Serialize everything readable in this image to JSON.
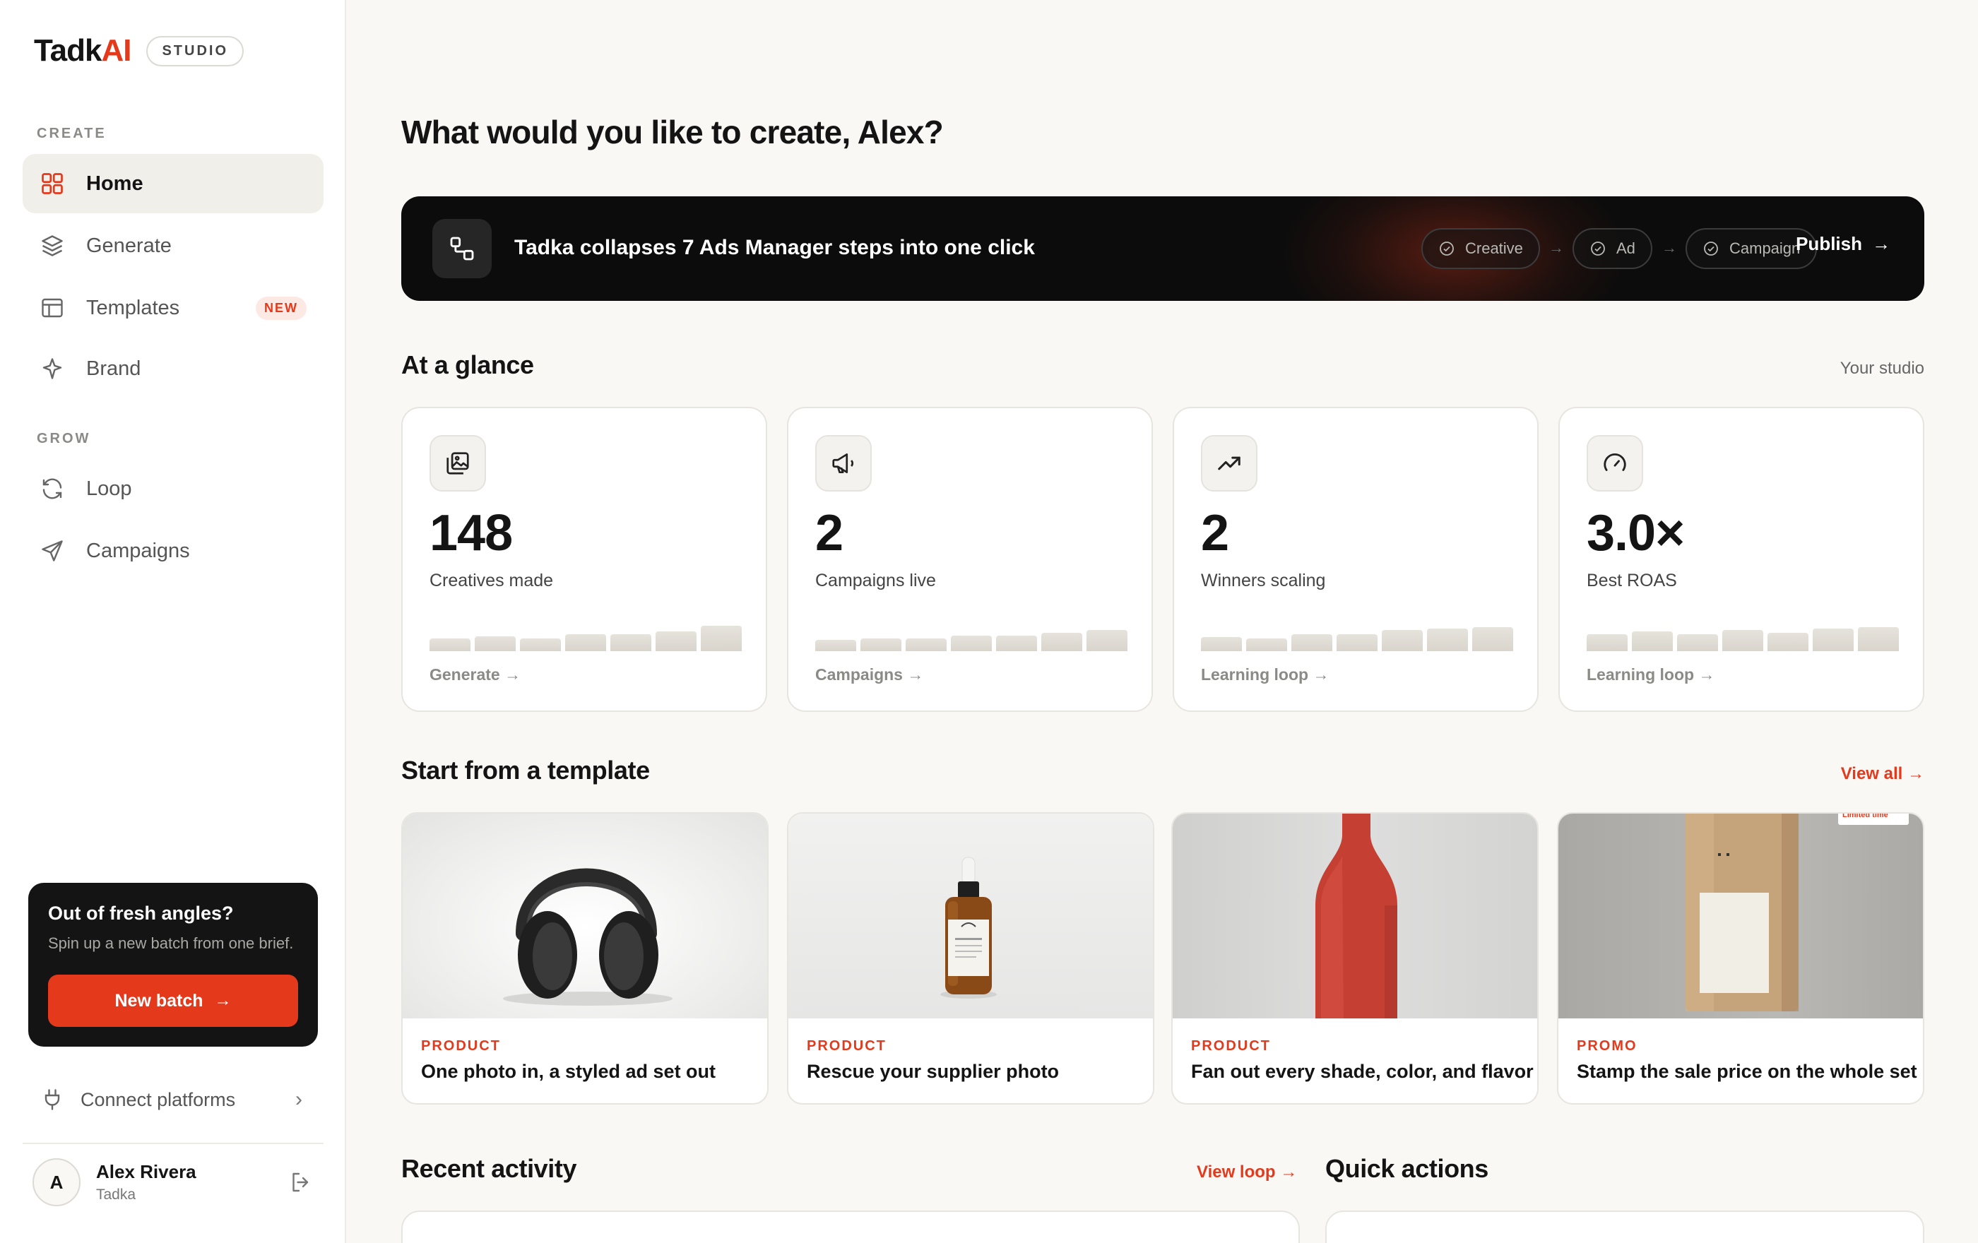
{
  "app": {
    "logo_main": "Tadk",
    "logo_ai": "AI",
    "studio_badge": "STUDIO"
  },
  "sidebar": {
    "create_label": "CREATE",
    "grow_label": "GROW",
    "create_items": [
      {
        "label": "Home",
        "icon": "grid-icon",
        "active": true
      },
      {
        "label": "Generate",
        "icon": "layers-icon"
      },
      {
        "label": "Templates",
        "icon": "layout-icon",
        "badge": "NEW"
      },
      {
        "label": "Brand",
        "icon": "sparkle-icon"
      }
    ],
    "grow_items": [
      {
        "label": "Loop",
        "icon": "refresh-icon"
      },
      {
        "label": "Campaigns",
        "icon": "send-icon"
      }
    ],
    "promo": {
      "title": "Out of fresh angles?",
      "subtitle": "Spin up a new batch from one brief.",
      "button": "New batch"
    },
    "connect_label": "Connect platforms",
    "user": {
      "initial": "A",
      "name": "Alex Rivera",
      "org": "Tadka"
    }
  },
  "main": {
    "greeting": "What would you like to create, Alex?",
    "banner": {
      "text": "Tadka collapses 7 Ads Manager steps into one click",
      "steps": [
        "Creative",
        "Ad",
        "Campaign"
      ],
      "publish": "Publish"
    },
    "glance": {
      "title": "At a glance",
      "right": "Your studio",
      "stats": [
        {
          "value": "148",
          "label": "Creatives made",
          "link": "Generate",
          "icon": "image-stack-icon",
          "trend": [
            0.45,
            0.52,
            0.45,
            0.6,
            0.6,
            0.7,
            0.9
          ]
        },
        {
          "value": "2",
          "label": "Campaigns live",
          "link": "Campaigns",
          "icon": "megaphone-icon",
          "trend": [
            0.4,
            0.45,
            0.45,
            0.55,
            0.55,
            0.65,
            0.75
          ]
        },
        {
          "value": "2",
          "label": "Winners scaling",
          "link": "Learning loop",
          "icon": "trend-up-icon",
          "trend": [
            0.5,
            0.45,
            0.6,
            0.6,
            0.75,
            0.8,
            0.85
          ]
        },
        {
          "value": "3.0×",
          "label": "Best ROAS",
          "link": "Learning loop",
          "icon": "gauge-icon",
          "trend": [
            0.6,
            0.7,
            0.6,
            0.75,
            0.65,
            0.8,
            0.85
          ]
        }
      ]
    },
    "templates": {
      "title": "Start from a template",
      "view_all": "View all",
      "items": [
        {
          "tag": "PRODUCT",
          "title": "One photo in, a styled ad set out",
          "image": "headphones"
        },
        {
          "tag": "PRODUCT",
          "title": "Rescue your supplier photo",
          "image": "serum-bottle"
        },
        {
          "tag": "PRODUCT",
          "title": "Fan out every shade, color, and flavor",
          "image": "red-bottle"
        },
        {
          "tag": "PROMO",
          "title": "Stamp the sale price on the whole set",
          "image": "coffee-bag",
          "sticker": "Limited time"
        }
      ]
    },
    "recent": {
      "title": "Recent activity",
      "view_loop": "View loop"
    },
    "quick": {
      "title": "Quick actions"
    }
  },
  "colors": {
    "accent": "#e5391c",
    "background": "#f9f8f5",
    "dark": "#0c0c0c"
  }
}
